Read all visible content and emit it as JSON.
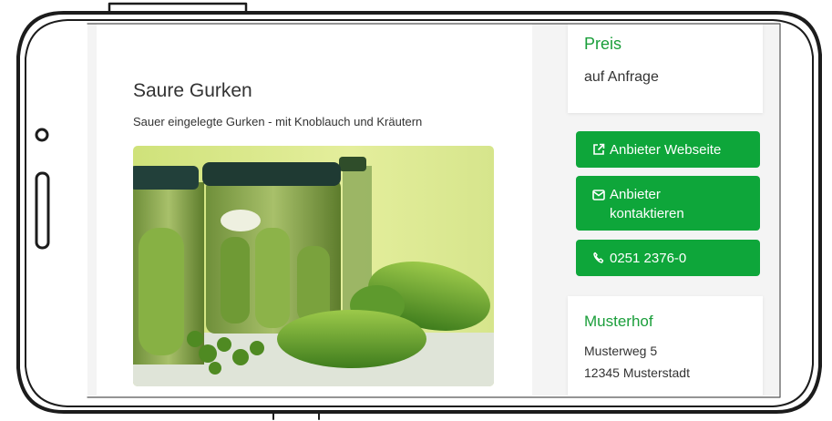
{
  "product": {
    "title": "Saure Gurken",
    "description": "Sauer eingelegte Gurken - mit Knoblauch und Kräutern"
  },
  "price": {
    "label": "Preis",
    "value": "auf Anfrage"
  },
  "actions": {
    "website_label": "Anbieter Webseite",
    "contact_label": "Anbieter kontaktieren",
    "phone_label": "0251 2376-0"
  },
  "vendor": {
    "name": "Musterhof",
    "street": "Musterweg 5",
    "city": "12345 Musterstadt"
  },
  "icons": {
    "website": "external-link-icon",
    "contact": "envelope-icon",
    "phone": "phone-icon"
  },
  "colors": {
    "accent_green": "#0ea63a",
    "heading_green": "#1a9e3a"
  }
}
